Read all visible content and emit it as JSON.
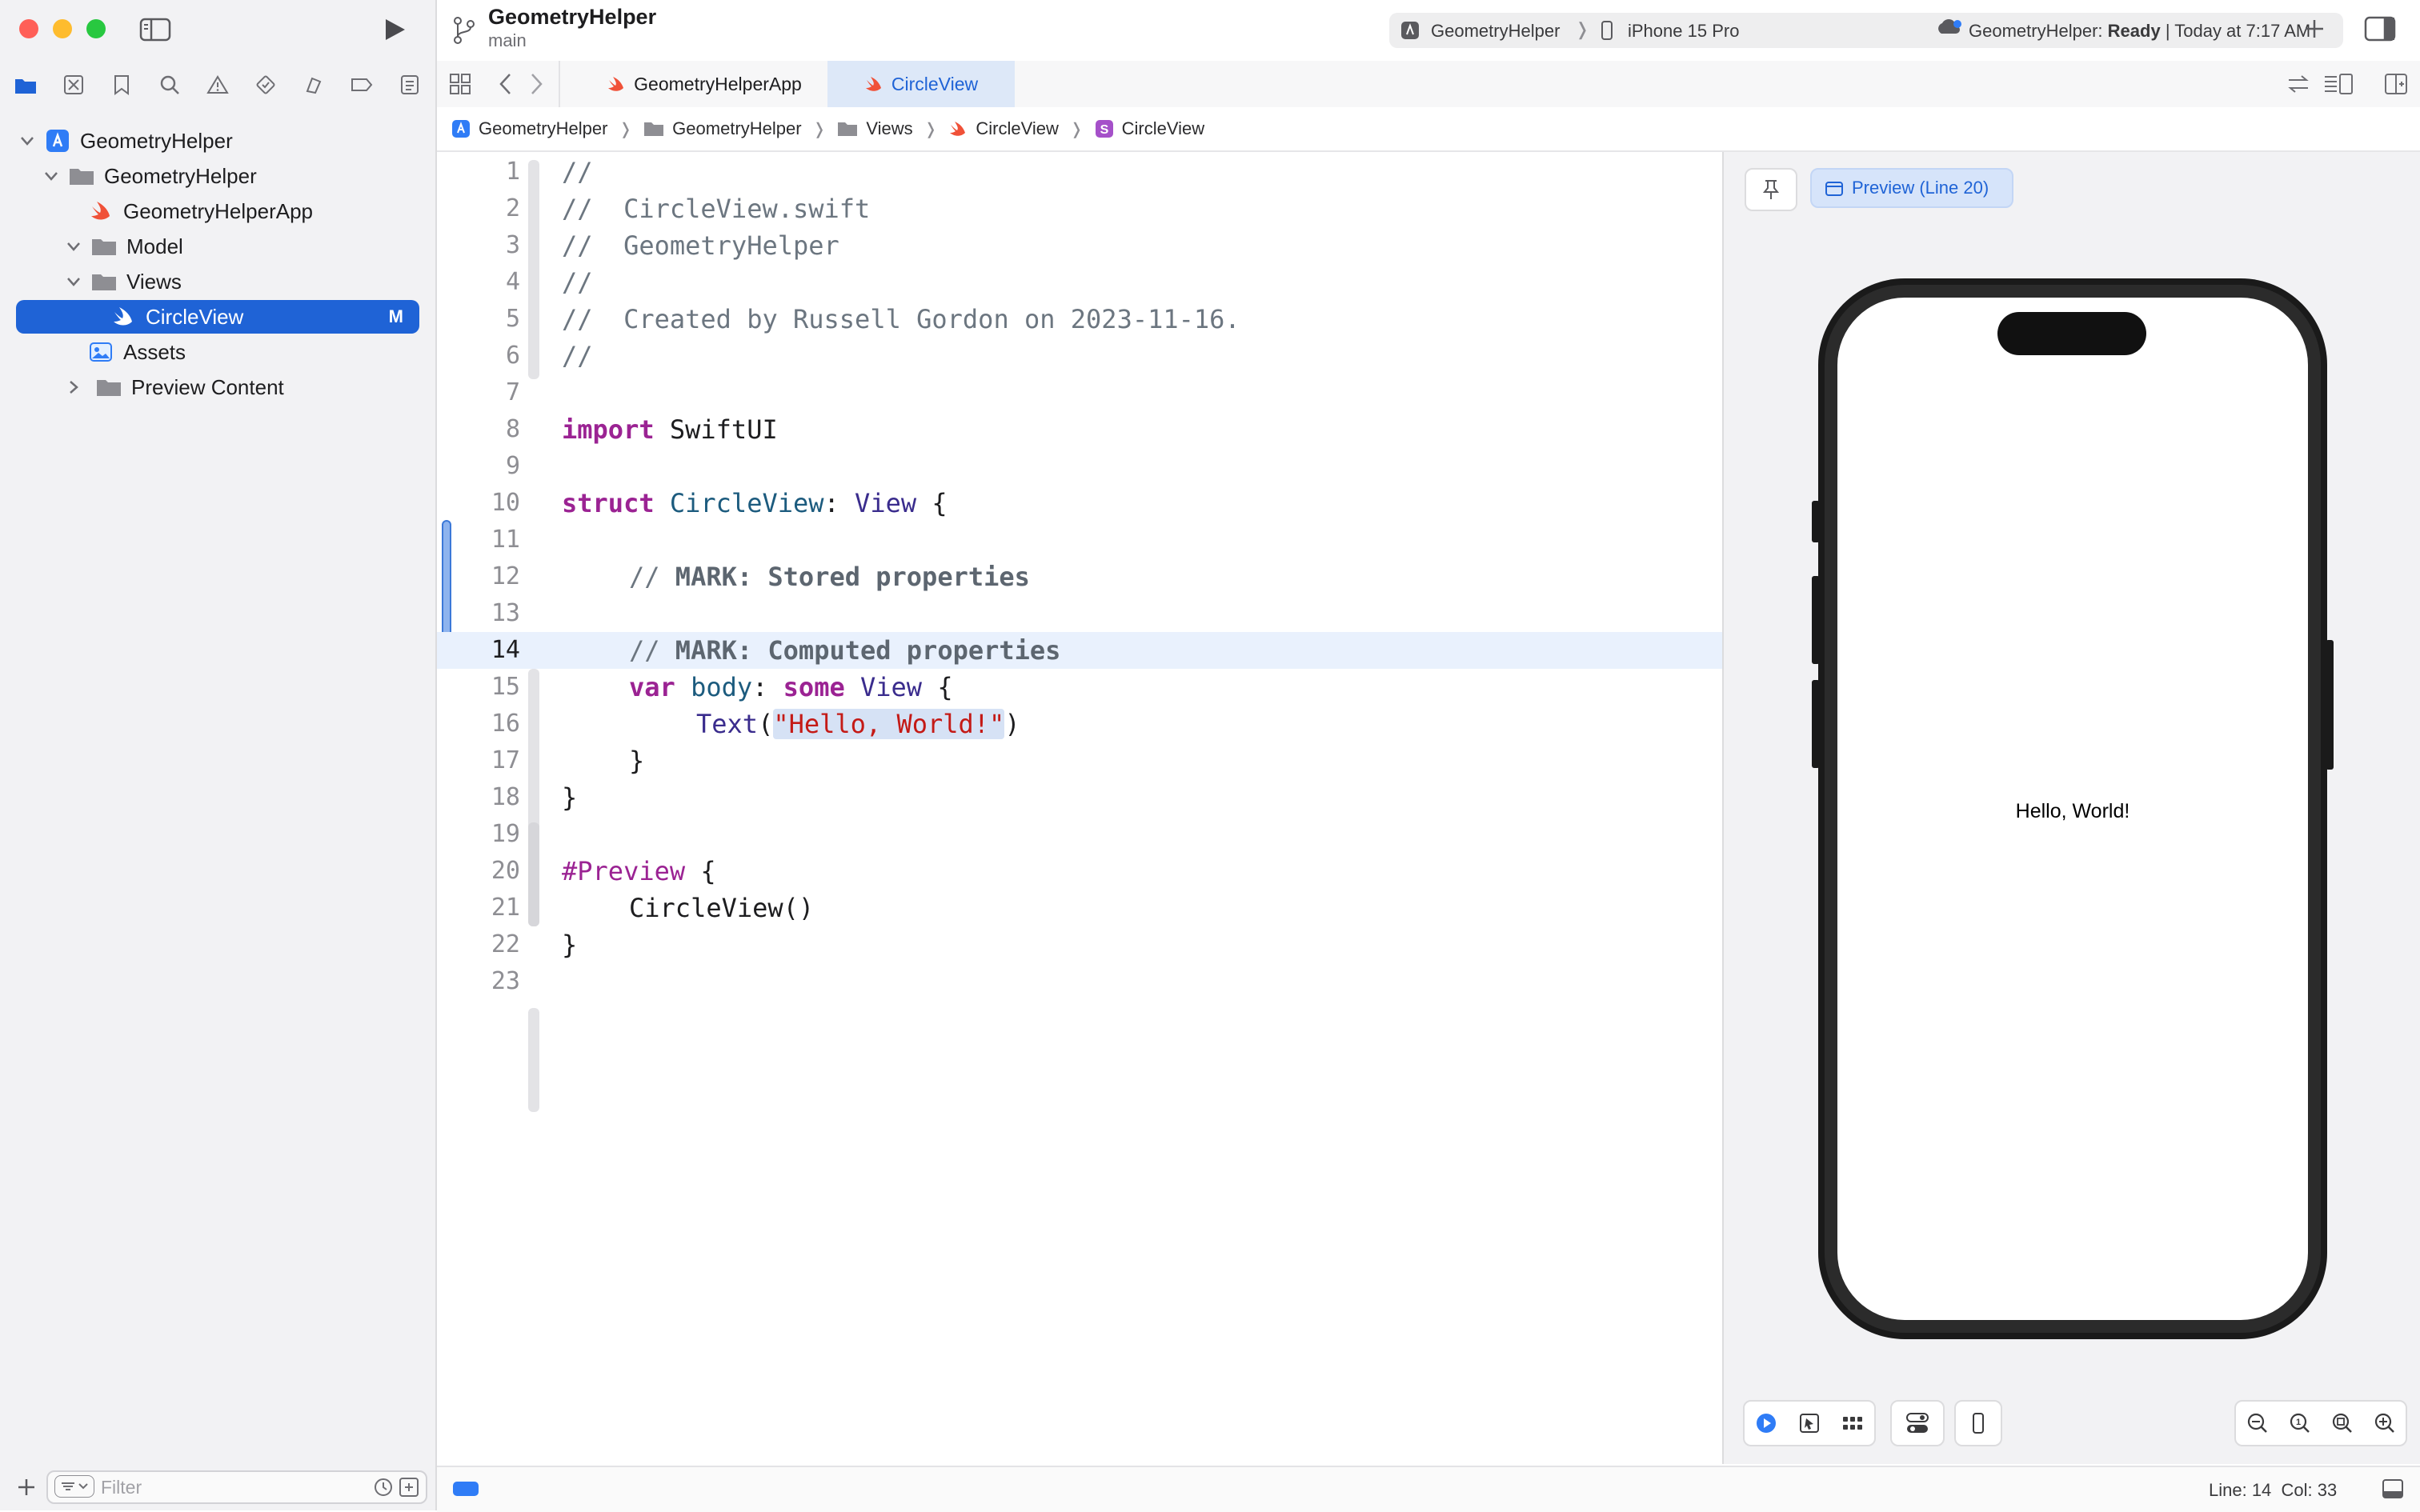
{
  "window": {
    "title": "GeometryHelper",
    "branch": "main"
  },
  "toolbar": {
    "scheme": "GeometryHelper",
    "destination": "iPhone 15 Pro",
    "status_app": "GeometryHelper:",
    "status_state": "Ready",
    "status_time": "| Today at 7:17 AM"
  },
  "navigator": {
    "tree": [
      {
        "label": "GeometryHelper",
        "icon": "project-icon"
      },
      {
        "label": "GeometryHelper",
        "icon": "folder-icon"
      },
      {
        "label": "GeometryHelperApp",
        "icon": "swift-file-icon"
      },
      {
        "label": "Model",
        "icon": "folder-icon"
      },
      {
        "label": "Views",
        "icon": "folder-icon"
      },
      {
        "label": "CircleView",
        "icon": "swift-file-icon",
        "badge": "M"
      },
      {
        "label": "Assets",
        "icon": "assets-icon"
      },
      {
        "label": "Preview Content",
        "icon": "folder-icon"
      }
    ],
    "filter_placeholder": "Filter"
  },
  "tabs": [
    {
      "label": "GeometryHelperApp"
    },
    {
      "label": "CircleView"
    }
  ],
  "breadcrumb": [
    "GeometryHelper",
    "GeometryHelper",
    "Views",
    "CircleView",
    "CircleView"
  ],
  "editor": {
    "line_numbers": [
      "1",
      "2",
      "3",
      "4",
      "5",
      "6",
      "7",
      "8",
      "9",
      "10",
      "11",
      "12",
      "13",
      "14",
      "15",
      "16",
      "17",
      "18",
      "19",
      "20",
      "21",
      "22",
      "23"
    ],
    "comments": {
      "l1": "//",
      "l2": "//  CircleView.swift",
      "l3": "//  GeometryHelper",
      "l4": "//",
      "l5": "//  Created by Russell Gordon on 2023-11-16.",
      "l6": "//"
    },
    "l8": {
      "kw": "import",
      "rest": " SwiftUI"
    },
    "l10": {
      "kw": "struct",
      "name": " CircleView",
      "colon": ": ",
      "type": "View",
      "brace": " {"
    },
    "l12": {
      "prefix": "// ",
      "mark": "MARK: Stored properties"
    },
    "l14": {
      "prefix": "// ",
      "mark": "MARK: Computed properties"
    },
    "l15": {
      "kw1": "var",
      "name": " body",
      "colon": ": ",
      "kw2": "some",
      "type": " View",
      "brace": " {"
    },
    "l16": {
      "fn": "Text",
      "open": "(",
      "str": "\"Hello, World!\"",
      "close": ")"
    },
    "l17": "}",
    "l18": "}",
    "l20": {
      "macro": "#Preview",
      "brace": " {"
    },
    "l21": {
      "call": "CircleView()"
    },
    "l22": "}"
  },
  "canvas": {
    "preview_label": "Preview (Line 20)",
    "preview_text": "Hello, World!"
  },
  "statusbar": {
    "line": "Line: 14",
    "col": "Col: 33"
  },
  "colors": {
    "accent": "#1f63d6",
    "swift_orange": "#f05138"
  }
}
